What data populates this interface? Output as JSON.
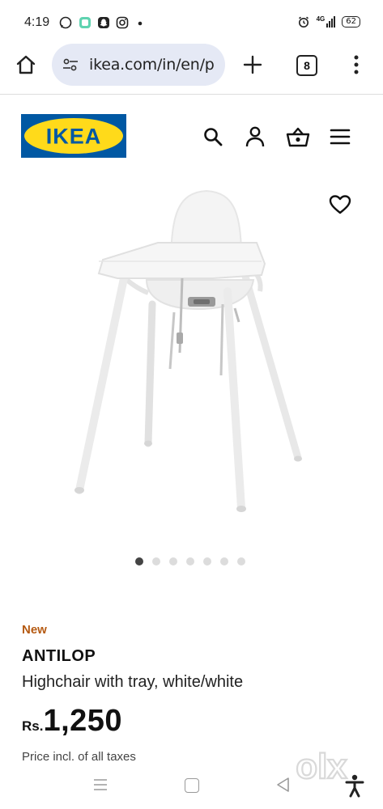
{
  "status_bar": {
    "time": "4:19",
    "network": "4G",
    "battery": "62",
    "notification_icons": [
      "whatsapp-icon",
      "app-icon",
      "snapchat-icon",
      "instagram-icon",
      "more-dot"
    ]
  },
  "browser": {
    "url": "ikea.com/in/en/p",
    "tab_count": "8"
  },
  "site": {
    "logo_text": "IKEA",
    "logo_colors": {
      "blue": "#0058a3",
      "yellow": "#ffda1a"
    }
  },
  "carousel": {
    "total": 7,
    "active_index": 0
  },
  "product": {
    "badge": "New",
    "name": "ANTILOP",
    "description": "Highchair with tray, white/white",
    "price_currency": "Rs.",
    "price_value": "1,250",
    "price_note": "Price incl. of all taxes"
  },
  "watermark": {
    "text": "olx"
  },
  "colors": {
    "badge_new": "#b55a12",
    "url_pill_bg": "#e5e9f5"
  }
}
